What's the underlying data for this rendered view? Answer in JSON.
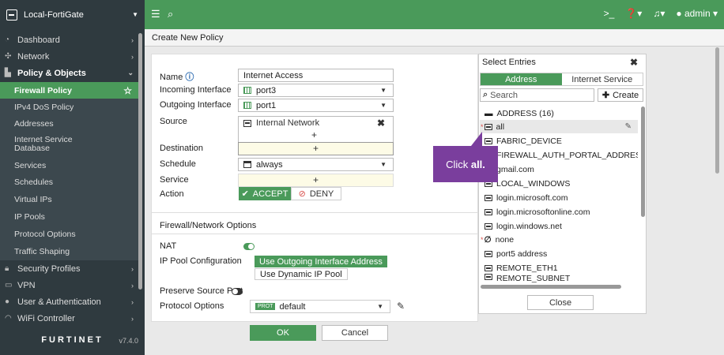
{
  "topbar": {
    "device": "Local-FortiGate",
    "admin": "admin"
  },
  "sidebar": {
    "items": [
      {
        "label": "Dashboard"
      },
      {
        "label": "Network"
      },
      {
        "label": "Policy & Objects"
      },
      {
        "label": "Security Profiles"
      },
      {
        "label": "VPN"
      },
      {
        "label": "User & Authentication"
      },
      {
        "label": "WiFi Controller"
      }
    ],
    "subitems": [
      {
        "label": "Firewall Policy"
      },
      {
        "label": "IPv4 DoS Policy"
      },
      {
        "label": "Addresses"
      },
      {
        "label": "Internet Service Database"
      },
      {
        "label": "Services"
      },
      {
        "label": "Schedules"
      },
      {
        "label": "Virtual IPs"
      },
      {
        "label": "IP Pools"
      },
      {
        "label": "Protocol Options"
      },
      {
        "label": "Traffic Shaping"
      }
    ],
    "logo": "FURTINET",
    "version": "v7.4.0"
  },
  "page": {
    "title": "Create New Policy"
  },
  "form": {
    "name_label": "Name",
    "name_value": "Internet Access",
    "incoming_label": "Incoming Interface",
    "incoming_value": "port3",
    "outgoing_label": "Outgoing Interface",
    "outgoing_value": "port1",
    "source_label": "Source",
    "source_value": "Internal Network",
    "destination_label": "Destination",
    "schedule_label": "Schedule",
    "schedule_value": "always",
    "service_label": "Service",
    "action_label": "Action",
    "accept_label": "ACCEPT",
    "deny_label": "DENY",
    "add_symbol": "+",
    "section_title": "Firewall/Network Options",
    "nat_label": "NAT",
    "ippool_label": "IP Pool Configuration",
    "ippool_opt1": "Use Outgoing Interface Address",
    "ippool_opt2": "Use Dynamic IP Pool",
    "preserve_label": "Preserve Source Port",
    "protocol_label": "Protocol Options",
    "protocol_badge": "PROT",
    "protocol_value": "default",
    "ok_label": "OK",
    "cancel_label": "Cancel"
  },
  "select_panel": {
    "title": "Select Entries",
    "tab_address": "Address",
    "tab_internet": "Internet Service",
    "search_placeholder": "Search",
    "create_label": "Create",
    "group_header": "ADDRESS (16)",
    "entries": [
      {
        "label": "all"
      },
      {
        "label": "FABRIC_DEVICE"
      },
      {
        "label": "FIREWALL_AUTH_PORTAL_ADDRESS"
      },
      {
        "label": "gmail.com"
      },
      {
        "label": "LOCAL_WINDOWS"
      },
      {
        "label": "login.microsoft.com"
      },
      {
        "label": "login.microsoftonline.com"
      },
      {
        "label": "login.windows.net"
      },
      {
        "label": "none"
      },
      {
        "label": "port5 address"
      },
      {
        "label": "REMOTE_ETH1"
      },
      {
        "label": "REMOTE_SUBNET"
      }
    ],
    "close_label": "Close"
  },
  "callout": {
    "prefix": "Click ",
    "emphasis": "all."
  },
  "colors": {
    "brand_green": "#4a9a5a",
    "sidebar_bg": "#2f3a3f",
    "callout_purple": "#7a3e9d"
  }
}
